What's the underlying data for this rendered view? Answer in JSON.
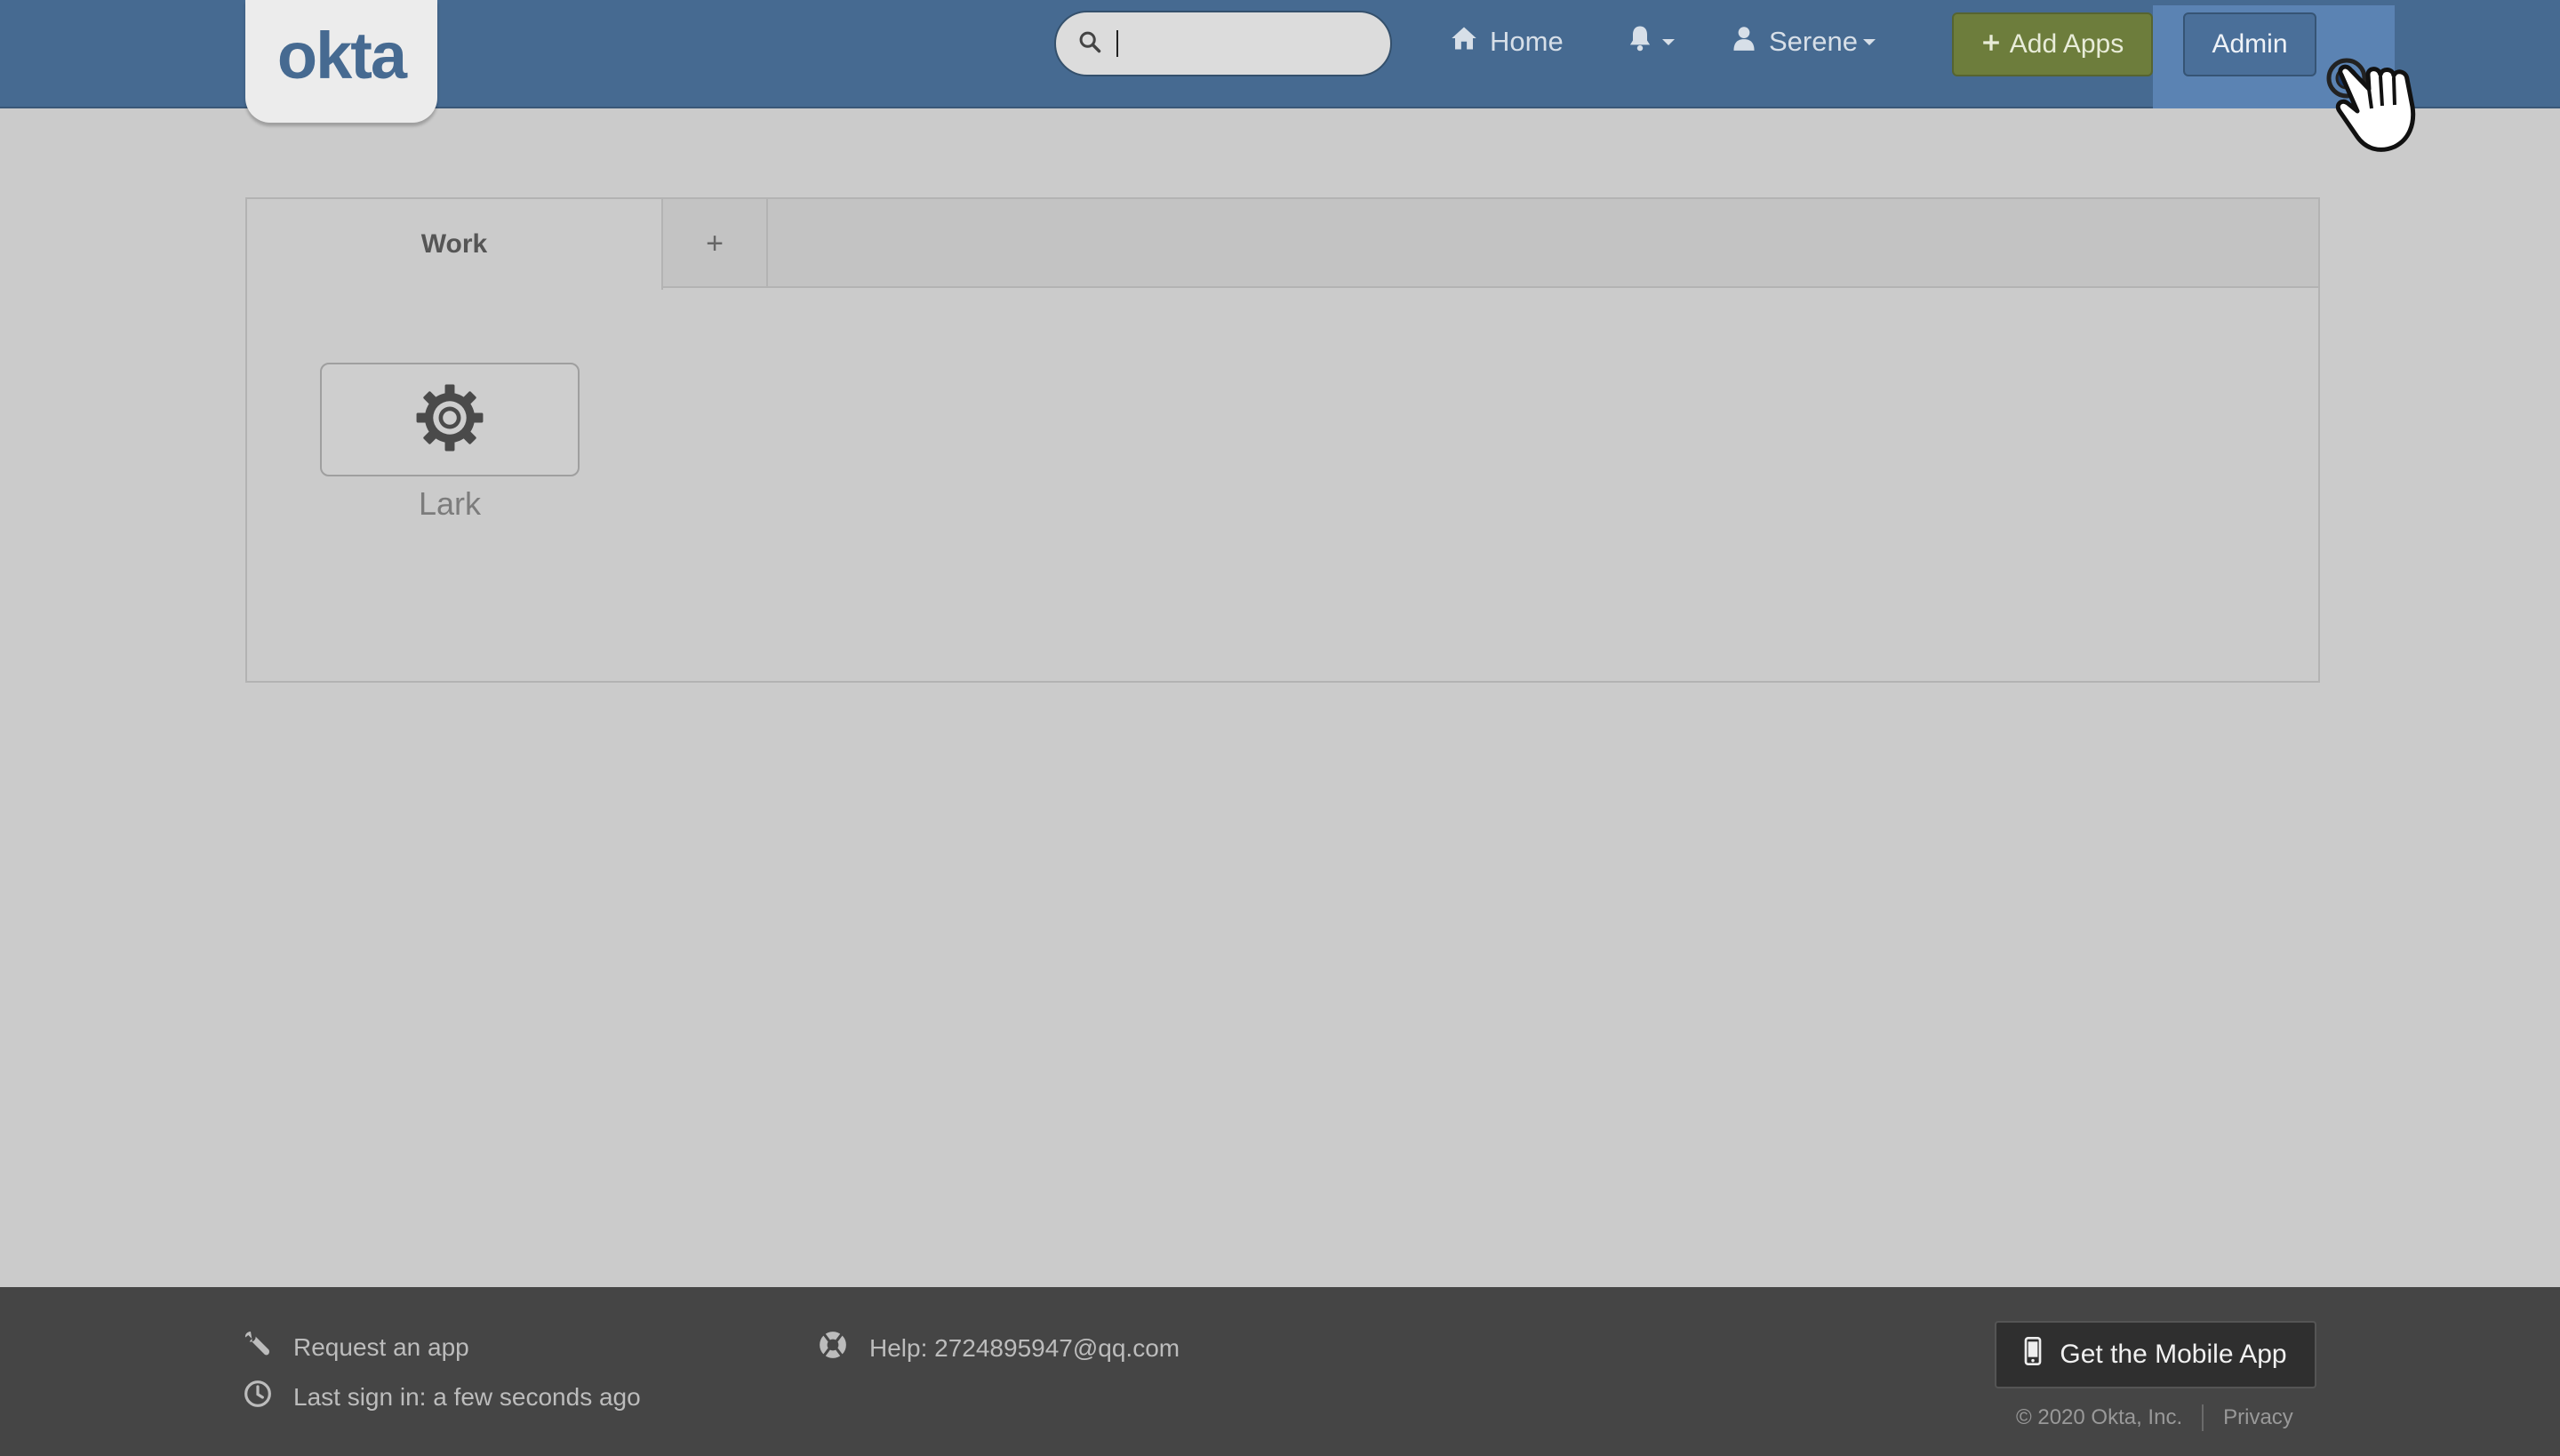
{
  "header": {
    "logo": "okta",
    "search": {
      "value": "",
      "placeholder": ""
    },
    "home_label": "Home",
    "user_label": "Serene",
    "add_apps_label": "Add Apps",
    "admin_label": "Admin",
    "icons": {
      "search": "search-icon",
      "home": "home-icon",
      "bell": "bell-icon",
      "user": "user-icon",
      "plus": "plus-icon"
    }
  },
  "tabs": [
    {
      "label": "Work",
      "active": true
    },
    {
      "label": "+",
      "active": false
    }
  ],
  "apps": [
    {
      "name": "Lark",
      "icon": "gear-icon"
    }
  ],
  "footer": {
    "request_app": "Request an app",
    "last_sign_in": "Last sign in: a few seconds ago",
    "help": "Help: 2724895947@qq.com",
    "mobile_app": "Get the Mobile App",
    "copyright": "© 2020 Okta, Inc.",
    "privacy": "Privacy"
  },
  "colors": {
    "header_bg": "#466a91",
    "add_apps_bg": "#6d7d3c",
    "admin_bg": "#4a6f99",
    "footer_bg": "#454545",
    "page_bg": "#cbcbcb"
  }
}
